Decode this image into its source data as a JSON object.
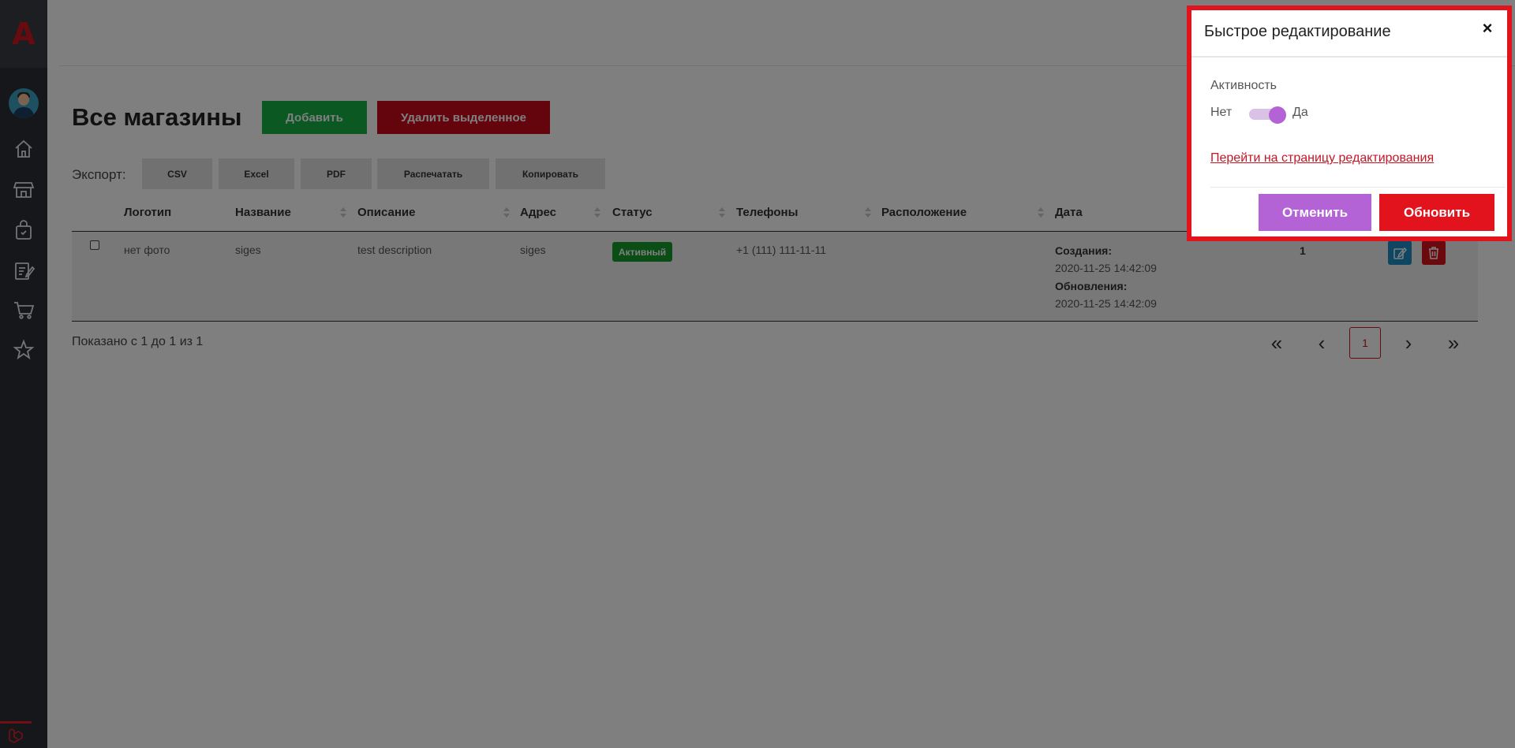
{
  "sidebar": {
    "logo_text": "A",
    "icons": [
      "home-icon",
      "store-icon",
      "shopping-bag-icon",
      "edit-document-icon",
      "cart-icon",
      "star-icon"
    ]
  },
  "page": {
    "title": "Все магазины",
    "add_label": "Добавить",
    "delete_selected_label": "Удалить выделенное"
  },
  "export": {
    "label": "Экспорт:",
    "buttons": [
      "CSV",
      "Excel",
      "PDF",
      "Распечатать",
      "Копировать"
    ]
  },
  "table": {
    "columns": [
      "Логотип",
      "Название",
      "Описание",
      "Адрес",
      "Статус",
      "Телефоны",
      "Расположение",
      "Дата"
    ],
    "rows": [
      {
        "logo": "нет фото",
        "name": "siges",
        "description": "test description",
        "address": "siges",
        "status": "Активный",
        "phones": "+1 (111) 111-11-11",
        "created_label": "Создания:",
        "created": "2020-11-25 14:42:09",
        "updated_label": "Обновления:",
        "updated": "2020-11-25 14:42:09",
        "count": "1"
      }
    ]
  },
  "footer": {
    "shown": "Показано с 1 до 1 из 1",
    "current_page": "1"
  },
  "modal": {
    "title": "Быстрое редактирование",
    "close": "×",
    "activity_label": "Активность",
    "toggle_off": "Нет",
    "toggle_on": "Да",
    "toggle_state": true,
    "edit_link": "Перейти на страницу редактирования",
    "cancel_label": "Отменить",
    "update_label": "Обновить"
  },
  "colors": {
    "brand_red": "#e2131c",
    "accent_purple": "#b463d6",
    "success_green": "#16b047"
  }
}
